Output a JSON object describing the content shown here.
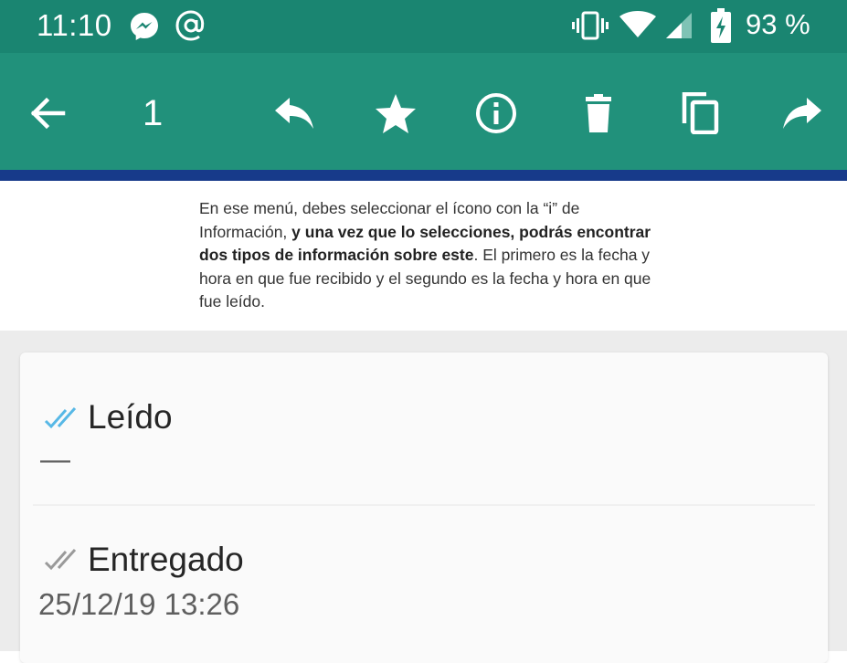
{
  "status_bar": {
    "time": "11:10",
    "battery": "93 %",
    "icons": [
      "messenger-icon",
      "at-icon",
      "vibrate-icon",
      "wifi-icon",
      "signal-icon",
      "battery-charging-icon"
    ]
  },
  "toolbar": {
    "selected_count": "1",
    "icons": [
      "back-arrow-icon",
      "reply-icon",
      "star-icon",
      "info-icon",
      "delete-icon",
      "copy-icon",
      "forward-icon"
    ],
    "color": "#21917b"
  },
  "article": {
    "text_1": "En ese menú, debes seleccionar el ícono con la “i” de Información, ",
    "text_bold": "y una vez que lo selecciones, podrás encontrar dos tipos de información sobre este",
    "text_2": ". El primero es la fecha y hora en que fue recibido y el segundo es la fecha y hora en que fue leído."
  },
  "message_info": {
    "read": {
      "label": "Leído",
      "value": "—",
      "check_color": "#57b8e6"
    },
    "delivered": {
      "label": "Entregado",
      "value": "25/12/19 13:26",
      "check_color": "#9a9a9a"
    }
  }
}
